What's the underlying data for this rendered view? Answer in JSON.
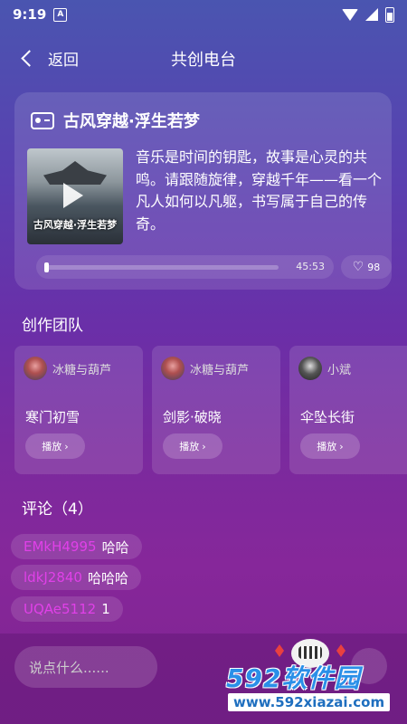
{
  "status": {
    "time": "9:19",
    "notif_icon": "A"
  },
  "nav": {
    "back_label": "返回",
    "title": "共创电台"
  },
  "radio": {
    "title": "古风穿越·浮生若梦",
    "cover_text": "古风穿越·浮生若梦",
    "description": "音乐是时间的钥匙，故事是心灵的共鸣。请跟随旋律，穿越千年——看一个凡人如何以凡躯，书写属于自己的传奇。",
    "duration": "45:53",
    "progress": 0.0,
    "likes": "98"
  },
  "team": {
    "title": "创作团队",
    "items": [
      {
        "member": "冰糖与葫芦",
        "song": "寒门初雪",
        "play": "播放"
      },
      {
        "member": "冰糖与葫芦",
        "song": "剑影·破晓",
        "play": "播放"
      },
      {
        "member": "小斌",
        "song": "伞坠长街",
        "play": "播放"
      }
    ]
  },
  "comments": {
    "title": "评论（4）",
    "items": [
      {
        "user": "EMkH4995",
        "text": "哈哈"
      },
      {
        "user": "ldkJ2840",
        "text": "哈哈哈"
      },
      {
        "user": "UQAe5112",
        "text": "1"
      }
    ]
  },
  "input": {
    "placeholder": "说点什么......"
  },
  "watermark": {
    "brand": "592软件园",
    "url": "www.592xiazai.com"
  },
  "colors": {
    "comment_user": "#e040e8",
    "watermark": "#2a8fe8"
  }
}
